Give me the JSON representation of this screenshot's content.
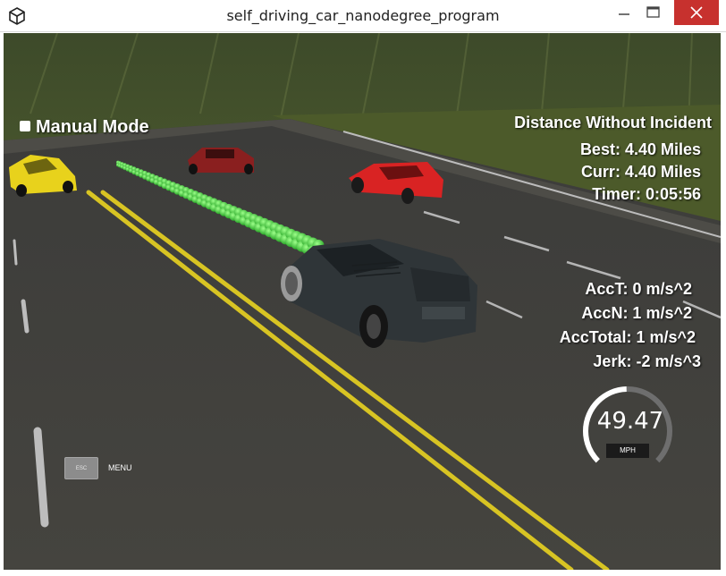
{
  "window": {
    "title": "self_driving_car_nanodegree_program",
    "app_icon": "unity-logo-icon",
    "buttons": [
      "minimize-icon",
      "maximize-icon",
      "close-icon"
    ],
    "close_color": "#c7312e"
  },
  "hud": {
    "mode_label": "Manual Mode",
    "stats": {
      "title": "Distance Without Incident",
      "best": "Best: 4.40 Miles",
      "curr": "Curr: 4.40 Miles",
      "timer": "Timer: 0:05:56"
    },
    "accel": {
      "acc_t": "AccT: 0 m/s^2",
      "acc_n": "AccN: 1 m/s^2",
      "acc_total": "AccTotal: 1 m/s^2",
      "jerk": "Jerk: -2 m/s^3"
    },
    "speedometer": {
      "value": "49.47",
      "unit": "MPH",
      "max_speed": 100
    },
    "esc_key": "ESC",
    "menu_label": "MENU"
  },
  "scene": {
    "ego_car_color": "#2f3538",
    "planned_path_color": "#3ce03c",
    "other_cars": [
      "#e8d21c",
      "#8a1f1f",
      "#d92323"
    ],
    "lane_line_color": "#d8c423"
  }
}
